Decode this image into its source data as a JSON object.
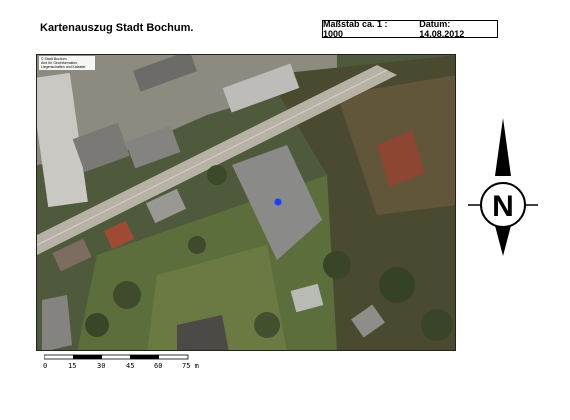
{
  "header": {
    "title": "Kartenauszug Stadt Bochum.",
    "scale_label": "Maßstab ca. 1 : 1000",
    "date_label": "Datum: 14.08.2012"
  },
  "map": {
    "copyright_lines": [
      "© Stadt Bochum",
      "Amt für Geoinformation,",
      "Liegenschaften und Kataster"
    ],
    "marker_color": "#1a3dff"
  },
  "scalebar": {
    "labels": [
      "0",
      "15",
      "30",
      "45",
      "60",
      "75 m"
    ]
  },
  "north_arrow": {
    "letter": "N"
  }
}
